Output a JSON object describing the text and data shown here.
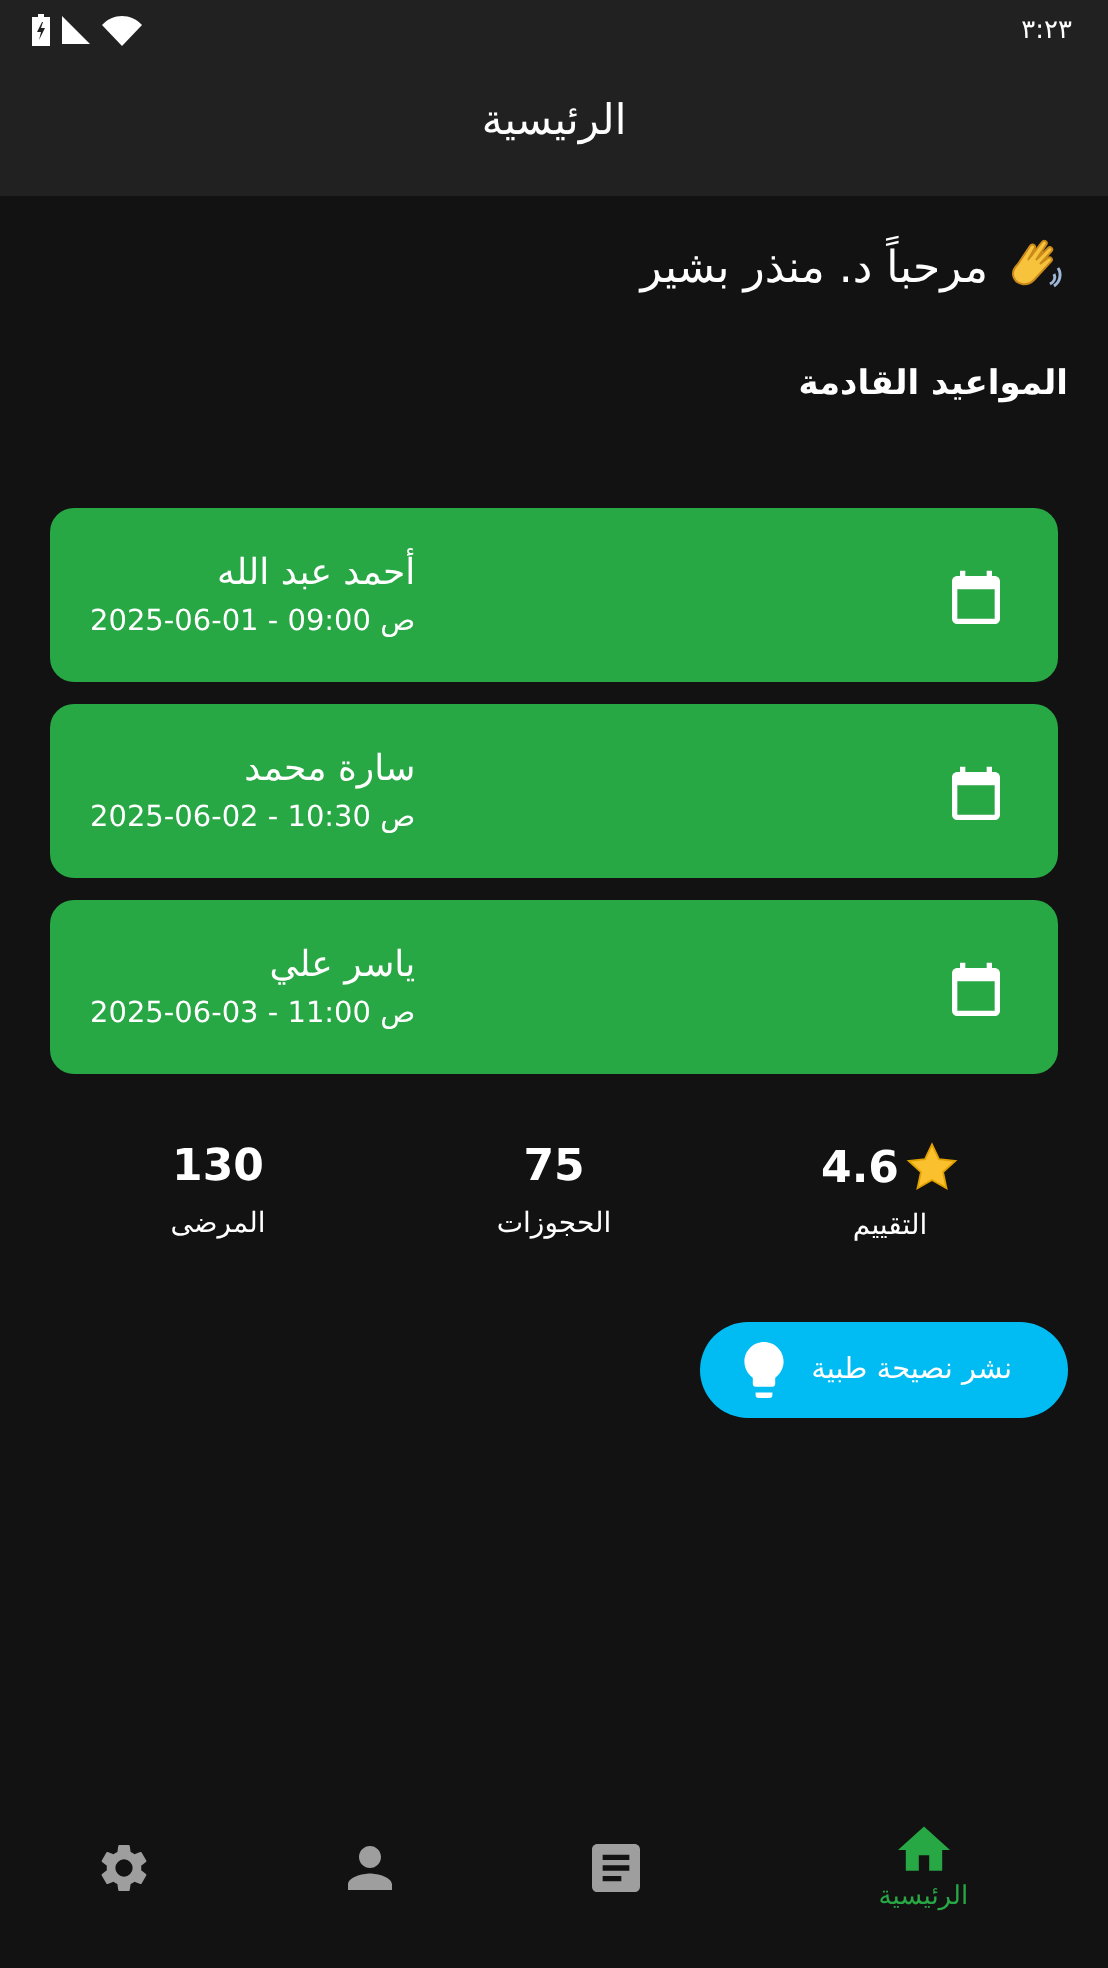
{
  "status_bar": {
    "time": "٣:٢٣"
  },
  "app_bar": {
    "title": "الرئيسية"
  },
  "greeting": "مرحباً د. منذر بشير",
  "section_title": "المواعيد القادمة",
  "appointments": [
    {
      "name": "أحمد عبد الله",
      "when": "2025-06-01 - 09:00 ص"
    },
    {
      "name": "سارة محمد",
      "when": "2025-06-02 - 10:30 ص"
    },
    {
      "name": "ياسر علي",
      "when": "2025-06-03 - 11:00 ص"
    }
  ],
  "stats": [
    {
      "kind": "rating",
      "value": "4.6",
      "label": "التقييم"
    },
    {
      "kind": "plain",
      "value": "75",
      "label": "الحجوزات"
    },
    {
      "kind": "plain",
      "value": "130",
      "label": "المرضى"
    }
  ],
  "tip_button": {
    "label": "نشر نصيحة طبية"
  },
  "bottom_nav": [
    {
      "kind": "home",
      "label": "الرئيسية",
      "selected": true
    },
    {
      "kind": "articles",
      "selected": false
    },
    {
      "kind": "profile",
      "selected": false
    },
    {
      "kind": "settings",
      "selected": false
    }
  ]
}
